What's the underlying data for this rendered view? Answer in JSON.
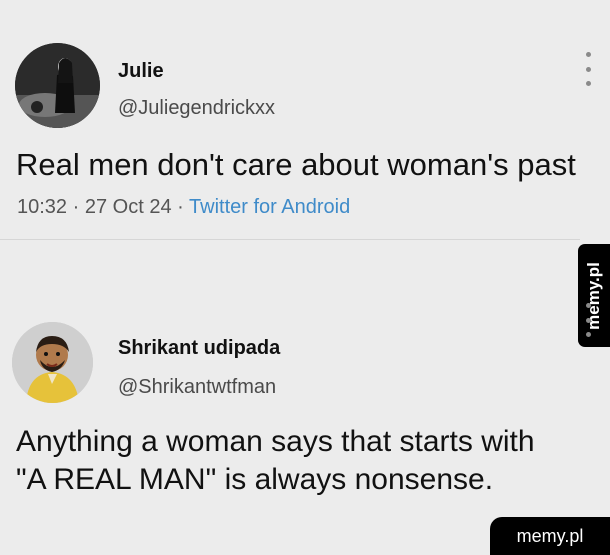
{
  "tweet1": {
    "name": "Julie",
    "handle": "@Juliegendrickxx",
    "text": "Real men don't care about woman's past",
    "time": "10:32",
    "date": "27 Oct 24",
    "client": "Twitter for Android"
  },
  "tweet2": {
    "name": "Shrikant udipada",
    "handle": "@Shrikantwtfman",
    "text_line1": "Anything a woman says that starts with",
    "text_line2": "\"A REAL MAN\" is always nonsense."
  },
  "watermark": {
    "side": "memy.pl",
    "corner": "memy.pl"
  },
  "separator": "·",
  "colors": {
    "background": "#ececec",
    "link": "#3f8bc9",
    "watermark_bg": "#000000"
  }
}
